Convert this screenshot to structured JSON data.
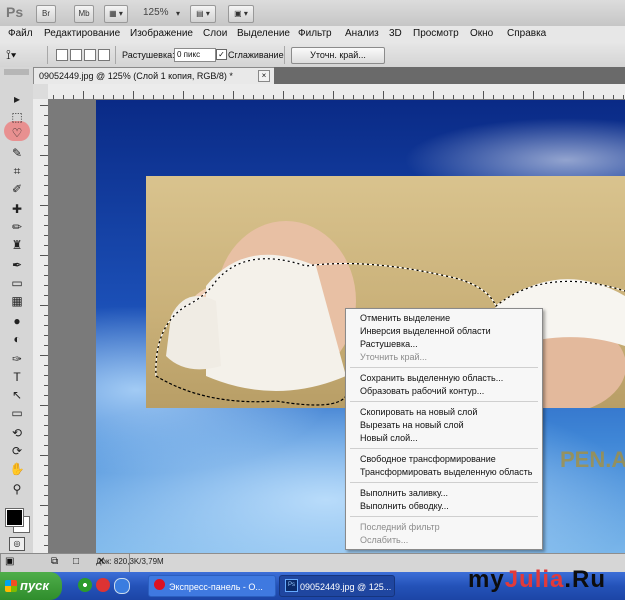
{
  "app": {
    "logo": "Ps",
    "bridge_label": "Br",
    "minibridge_label": "Mb",
    "zoom": "125%"
  },
  "menu": [
    "Файл",
    "Редактирование",
    "Изображение",
    "Слои",
    "Выделение",
    "Фильтр",
    "Анализ",
    "3D",
    "Просмотр",
    "Окно",
    "Справка"
  ],
  "options": {
    "feather_label": "Растушевка:",
    "feather_value": "0 пикс",
    "antialias_checked": "✓",
    "antialias_label": "Сглаживание",
    "refine_edge_button": "Уточн. край..."
  },
  "document": {
    "tab_title": "09052449.jpg @ 125% (Слой 1 копия, RGB/8) *",
    "close_glyph": "×",
    "image_watermark": "PEN.AZ",
    "doc_size": "Док: 820,3K/3,79M"
  },
  "tools": [
    {
      "icon": "move-icon",
      "glyph": "▸"
    },
    {
      "icon": "marquee-icon",
      "glyph": "⬚"
    },
    {
      "icon": "lasso-icon",
      "glyph": "♡"
    },
    {
      "icon": "quick-select-icon",
      "glyph": "✎"
    },
    {
      "icon": "crop-icon",
      "glyph": "⌗"
    },
    {
      "icon": "eyedropper-icon",
      "glyph": "✐"
    },
    {
      "icon": "healing-icon",
      "glyph": "✚"
    },
    {
      "icon": "brush-icon",
      "glyph": "✏"
    },
    {
      "icon": "stamp-icon",
      "glyph": "♜"
    },
    {
      "icon": "history-brush-icon",
      "glyph": "✒"
    },
    {
      "icon": "eraser-icon",
      "glyph": "▭"
    },
    {
      "icon": "gradient-icon",
      "glyph": "▦"
    },
    {
      "icon": "blur-icon",
      "glyph": "●"
    },
    {
      "icon": "dodge-icon",
      "glyph": "◐"
    },
    {
      "icon": "pen-icon",
      "glyph": "✑"
    },
    {
      "icon": "type-icon",
      "glyph": "T"
    },
    {
      "icon": "path-select-icon",
      "glyph": "↖"
    },
    {
      "icon": "shape-icon",
      "glyph": "▭"
    },
    {
      "icon": "3d-rotate-icon",
      "glyph": "⟲"
    },
    {
      "icon": "3d-orbit-icon",
      "glyph": "⟳"
    },
    {
      "icon": "hand-icon",
      "glyph": "✋"
    },
    {
      "icon": "zoom-icon",
      "glyph": "⚲"
    }
  ],
  "context_menu": {
    "items": [
      {
        "label": "Отменить выделение",
        "enabled": true
      },
      {
        "label": "Инверсия выделенной области",
        "enabled": true
      },
      {
        "label": "Растушевка...",
        "enabled": true
      },
      {
        "label": "Уточнить край...",
        "enabled": false
      },
      {
        "label": "Сохранить выделенную область...",
        "enabled": true
      },
      {
        "label": "Образовать рабочий контур...",
        "enabled": true
      },
      {
        "label": "Скопировать на новый слой",
        "enabled": true
      },
      {
        "label": "Вырезать на новый слой",
        "enabled": true
      },
      {
        "label": "Новый слой...",
        "enabled": true
      },
      {
        "label": "Свободное трансформирование",
        "enabled": true
      },
      {
        "label": "Трансформировать выделенную область",
        "enabled": true
      },
      {
        "label": "Выполнить заливку...",
        "enabled": true
      },
      {
        "label": "Выполнить обводку...",
        "enabled": true
      },
      {
        "label": "Последний фильтр",
        "enabled": false
      },
      {
        "label": "Ослабить...",
        "enabled": false
      }
    ]
  },
  "taskbar": {
    "start": "пуск",
    "tasks": [
      "Экспресс-панель - О...",
      "09052449.jpg @ 125..."
    ]
  },
  "watermark": {
    "before": "my",
    "accent": "Julia",
    "after": ".Ru"
  },
  "colors": {
    "highlight": "#ff5a78",
    "desktop_blue": "#1b4fb6",
    "sand": "#c9b078"
  }
}
